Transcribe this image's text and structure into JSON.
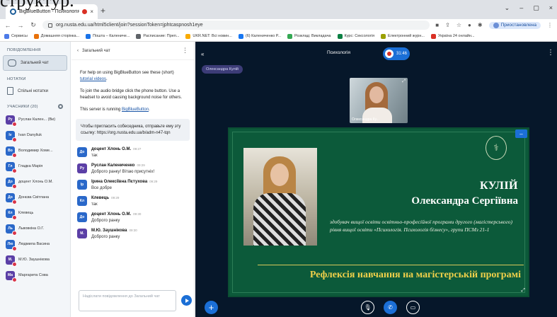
{
  "caption": "структур.",
  "browser": {
    "tab_title": "BigBlueButton - Психологія",
    "tab_close": "×",
    "new_tab": "+",
    "window_controls": [
      "⌄",
      "–",
      "▢",
      "×"
    ],
    "url": "org.nusta.edu.ua/html5client/join?sessionToken=jphtcaspnosh1eye",
    "profile_label": "Приостановлена",
    "bookmarks": [
      {
        "label": "Сервисы",
        "color": "#4d7be8"
      },
      {
        "label": "Домашняя сторінка...",
        "color": "#e8710a"
      },
      {
        "label": "Пошта – Калениче...",
        "color": "#1a73e8"
      },
      {
        "label": "Расписание: Преп...",
        "color": "#5f6368"
      },
      {
        "label": "UKR.NET: Всі новин...",
        "color": "#f9ab00"
      },
      {
        "label": "(6) Калениченко Р...",
        "color": "#1877f2"
      },
      {
        "label": "Розклад: Викладача",
        "color": "#34a853"
      },
      {
        "label": "Курс: Сексологія",
        "color": "#0b8043"
      },
      {
        "label": "Електронний журн...",
        "color": "#9aa000"
      },
      {
        "label": "Україна 24 онлайн...",
        "color": "#d93025"
      }
    ]
  },
  "user_panel": {
    "messages_head": "ПОВІДОМЛЕННЯ",
    "public_chat": "Загальний чат",
    "notes_head": "НОТАТКИ",
    "shared_notes": "Спільні нотатки",
    "users_head": "УЧАСНИКИ (20)",
    "users": [
      {
        "initials": "Ру",
        "name": "Руслан Кален... (Ви)",
        "color": "#5b3fa6"
      },
      {
        "initials": "Iv",
        "name": "Ivan Danyliuk",
        "color": "#2a68c9"
      },
      {
        "initials": "Во",
        "name": "Володимир Хоме...",
        "color": "#2a68c9"
      },
      {
        "initials": "Гл",
        "name": "Гладка Марія",
        "color": "#2a68c9"
      },
      {
        "initials": "До",
        "name": "доцент Хлонь О.М.",
        "color": "#2a68c9"
      },
      {
        "initials": "До",
        "name": "Донєва Світлана",
        "color": "#2a68c9"
      },
      {
        "initials": "Кл",
        "name": "Клевець",
        "color": "#2a68c9"
      },
      {
        "initials": "Ль",
        "name": "Львовкіна О.Г.",
        "color": "#2a68c9"
      },
      {
        "initials": "Лю",
        "name": "Людмила Васина",
        "color": "#2a68c9"
      },
      {
        "initials": "М.",
        "name": "М.Ю. Заушнікова",
        "color": "#5b3fa6"
      },
      {
        "initials": "Ма",
        "name": "Маргарита Сова",
        "color": "#5b3fa6"
      }
    ]
  },
  "chat": {
    "title": "Загальний чат",
    "welcome": {
      "line1_pre": "For help on using BigBlueButton see these (short) ",
      "line1_link": "tutorial videos",
      "line1_post": ".",
      "line2": "To join the audio bridge click the phone button. Use a headset to avoid causing background noise for others.",
      "line3_pre": "This server is running ",
      "line3_link": "BigBlueButton",
      "line3_post": "."
    },
    "invite": "Чтобы пригласить собеседника, отправьте ему эту ссылку: https://org.nusta.edu.ua/b/adm-n47-tqn",
    "messages": [
      {
        "initials": "До",
        "name": "доцент Хлонь О.М.",
        "time": "09:27",
        "text": "так",
        "color": "#2a68c9"
      },
      {
        "initials": "Ру",
        "name": "Руслан Калениченко",
        "time": "09:29",
        "text": "Доброго ранку! Вітаю присутніх!",
        "color": "#5b3fa6"
      },
      {
        "initials": "Ір",
        "name": "Ірина Олексіївна Пєтухова",
        "time": "09:29",
        "text": "Все добре",
        "color": "#2a68c9"
      },
      {
        "initials": "Кл",
        "name": "Клевець",
        "time": "09:29",
        "text": "так",
        "color": "#2a68c9"
      },
      {
        "initials": "До",
        "name": "доцент Хлонь О.М.",
        "time": "09:30",
        "text": "Доброго ранку",
        "color": "#2a68c9"
      },
      {
        "initials": "М.",
        "name": "М.Ю. Заушнікова",
        "time": "09:30",
        "text": "Доброго ранку",
        "color": "#5b3fa6"
      }
    ],
    "input_placeholder": "Надіслати повідомлення до Загальний чат"
  },
  "main": {
    "meeting_title": "Психологія",
    "rec_time": "31:46",
    "talking": "Олександра Кулій",
    "webcam_name": "Олександра Ку...",
    "slide": {
      "surname": "КУЛІЙ",
      "fullname": "Олександра Сергіївна",
      "description": "здобувач вищої освіти освітньо-професійної програми другого (магістерського) рівня вищої освіти «Психологія. Психологія бізнесу», групи ПСМз 21-1",
      "topic": "Рефлексія навчання на магістерській програмі",
      "emblem": "⚕"
    }
  },
  "colors": {
    "accent": "#1b6fd6",
    "main_bg": "#06172a",
    "slide_green": "#0c5a3a",
    "topic_gold": "#f0d04a",
    "mic_off": "#d8354a"
  }
}
